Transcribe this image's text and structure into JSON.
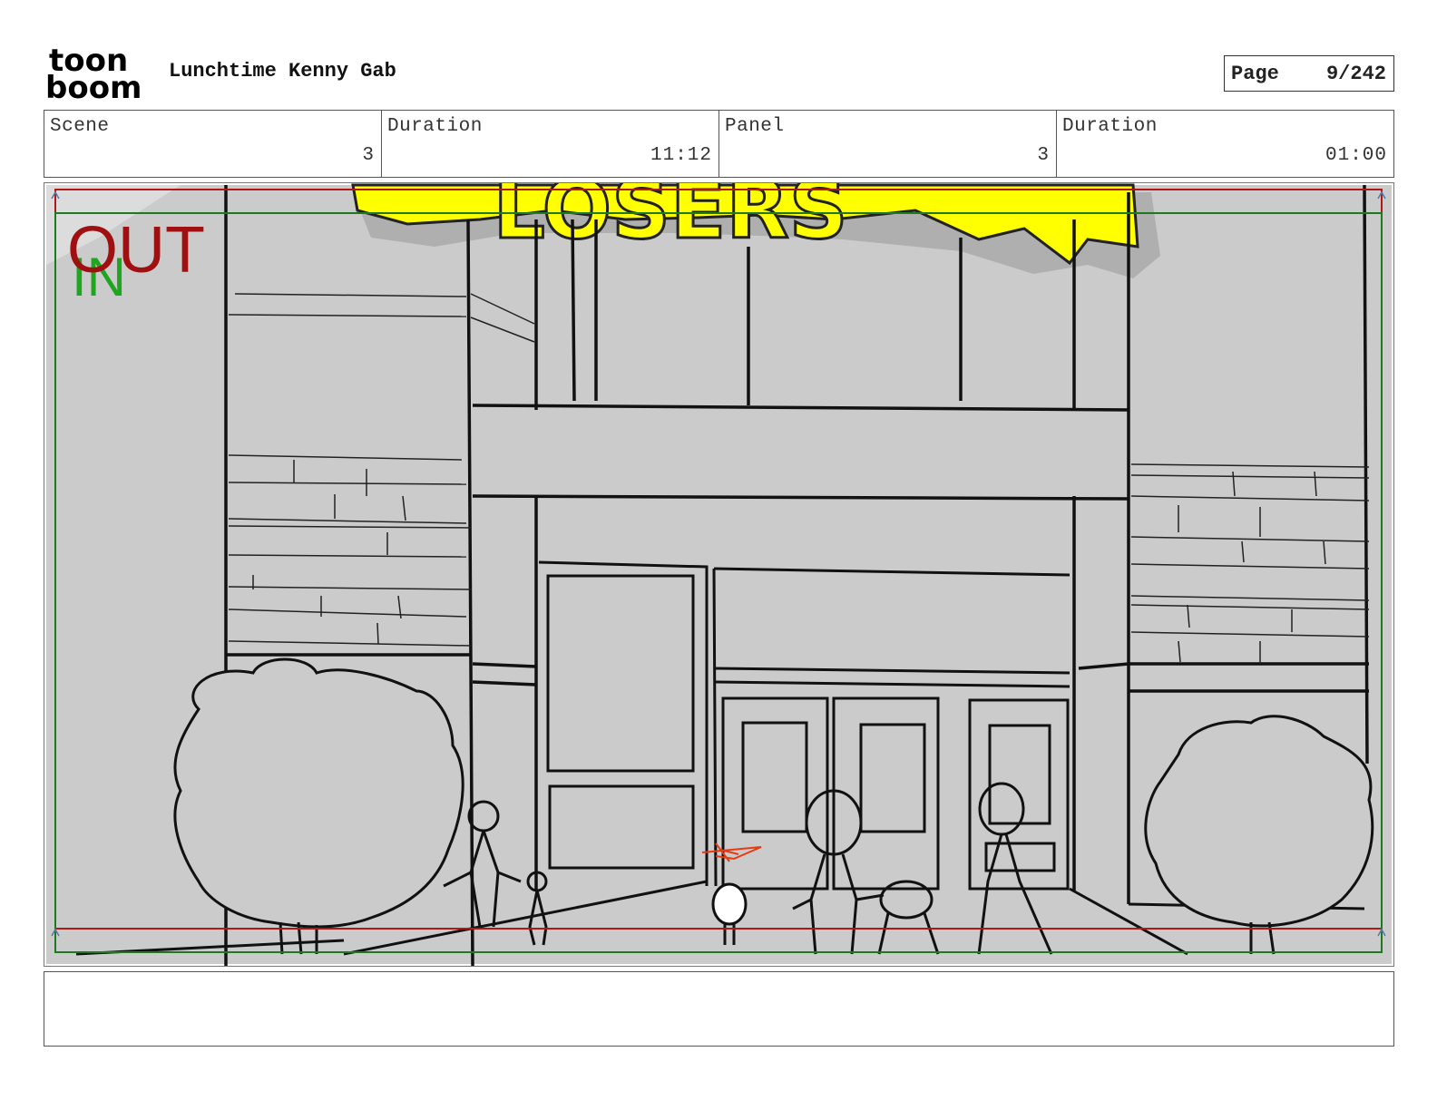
{
  "header": {
    "logo_text_top": "toon",
    "logo_text_bottom": "boom",
    "project_title": "Lunchtime Kenny Gab",
    "page_label": "Page",
    "page_value": "9/242"
  },
  "info": {
    "scene_label": "Scene",
    "scene_value": "3",
    "scene_duration_label": "Duration",
    "scene_duration_value": "11:12",
    "panel_label": "Panel",
    "panel_value": "3",
    "panel_duration_label": "Duration",
    "panel_duration_value": "01:00"
  },
  "panel": {
    "out_marker": "OUT",
    "in_marker": "IN",
    "sign_text": "LOSERS",
    "colors": {
      "background": "#cbcbcb",
      "out_frame": "#b01818",
      "in_frame": "#1e7a1e",
      "sign_fill": "#ffff00",
      "sketch_accent": "#e83a10"
    }
  },
  "notes": {
    "text": ""
  }
}
